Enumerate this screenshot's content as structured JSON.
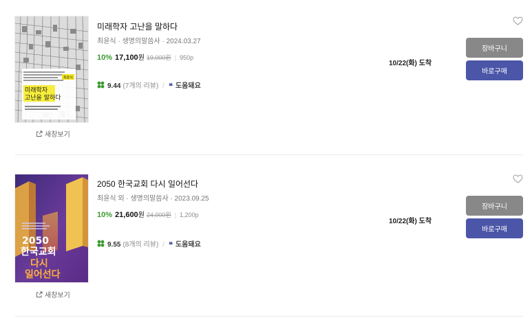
{
  "items": [
    {
      "title": "미래학자 고난을 말하다",
      "meta": "최윤식 · 생명의말씀사 · 2024.03.27",
      "discount": "10%",
      "price": "17,100",
      "won": "원",
      "original_price": "19,000원",
      "pages": "950p",
      "rating": "9.44",
      "review_count": "(7개의 리뷰)",
      "helpful": "도움돼요",
      "delivery": "10/22(화) 도착",
      "cart_label": "장바구니",
      "buy_label": "바로구매",
      "new_window": "새창보기",
      "cover_texts": {
        "badge": "최윤식",
        "title_line1": "미래학자",
        "title_line2": "고난을 말하다"
      }
    },
    {
      "title": "2050 한국교회 다시 일어선다",
      "meta": "최윤식 외 · 생명의말씀사 · 2023.09.25",
      "discount": "10%",
      "price": "21,600",
      "won": "원",
      "original_price": "24,000원",
      "pages": "1,200p",
      "rating": "9.55",
      "review_count": "(8개의 리뷰)",
      "helpful": "도움돼요",
      "delivery": "10/22(화) 도착",
      "cart_label": "장바구니",
      "buy_label": "바로구매",
      "new_window": "새창보기",
      "cover_texts": {
        "line1": "2050",
        "line2": "한국교회",
        "line3": "다시",
        "line4": "일어선다"
      }
    }
  ],
  "colors": {
    "discount": "#3a9b2f",
    "buy_button": "#4b56a8",
    "cart_button": "#888888",
    "rating_clover": "#3a9b2f"
  },
  "icons": [
    "heart-icon",
    "clover-icon",
    "quote-icon",
    "new-window-icon"
  ]
}
